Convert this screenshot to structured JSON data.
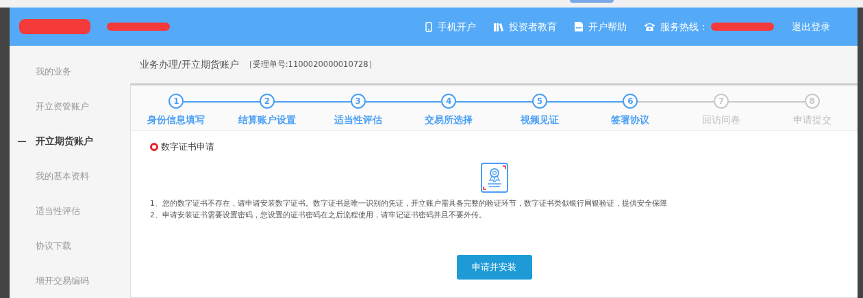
{
  "header": {
    "links": [
      {
        "kind": "phone",
        "label": "手机开户"
      },
      {
        "kind": "books",
        "label": "投资者教育"
      },
      {
        "kind": "doc",
        "label": "开户帮助"
      },
      {
        "kind": "hotline",
        "label": "服务热线："
      },
      {
        "kind": "plain",
        "label": "退出登录"
      }
    ]
  },
  "sidebar": {
    "items": [
      {
        "label": "我的业务",
        "selected": false
      },
      {
        "label": "开立资管账户",
        "selected": false
      },
      {
        "label": "开立期货账户",
        "selected": true
      },
      {
        "label": "我的基本资料",
        "selected": false
      },
      {
        "label": "适当性评估",
        "selected": false
      },
      {
        "label": "协议下载",
        "selected": false
      },
      {
        "label": "增开交易编码",
        "selected": false
      }
    ]
  },
  "breadcrumb": {
    "path": "业务办理/开立期货账户",
    "ticket": "［受理单号:1100020000010728］"
  },
  "steps": [
    {
      "number": "1",
      "label": "身份信息填写",
      "completed": true
    },
    {
      "number": "2",
      "label": "结算账户设置",
      "completed": true
    },
    {
      "number": "3",
      "label": "适当性评估",
      "completed": true
    },
    {
      "number": "4",
      "label": "交易所选择",
      "completed": true
    },
    {
      "number": "5",
      "label": "视频见证",
      "completed": true
    },
    {
      "number": "6",
      "label": "签署协议",
      "completed": true
    },
    {
      "number": "7",
      "label": "回访问卷",
      "completed": false
    },
    {
      "number": "8",
      "label": "申请提交",
      "completed": false
    }
  ],
  "section": {
    "title": "数字证书申请",
    "notes": [
      "1、您的数字证书不存在，请申请安装数字证书。数字证书是唯一识别的凭证，开立账户需具备完整的验证环节，数字证书类似银行网银验证，提供安全保障",
      "2、申请安装证书需要设置密码，您设置的证书密码在之后流程使用，请牢记证书密码并且不要外传。"
    ],
    "button": "申请并安装"
  }
}
